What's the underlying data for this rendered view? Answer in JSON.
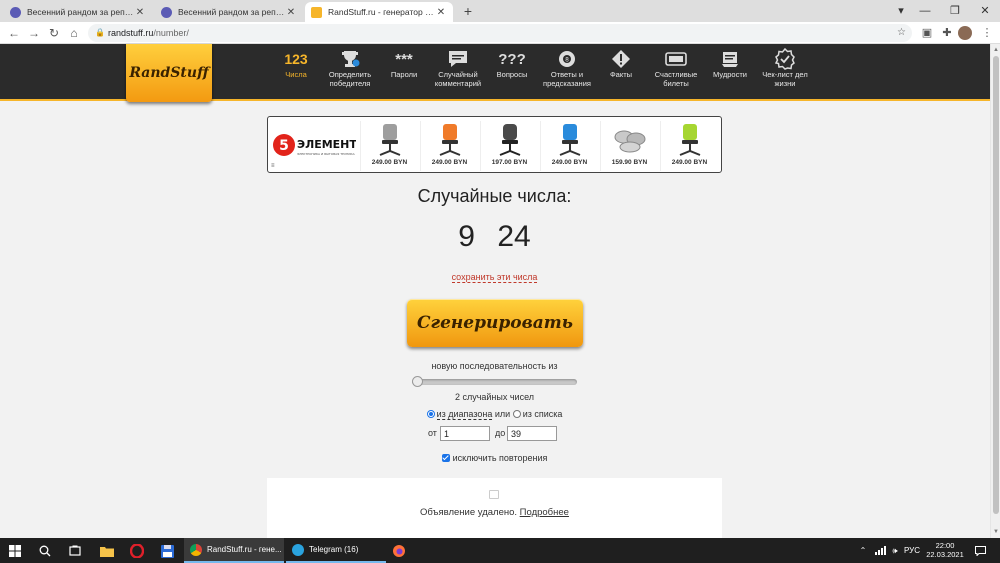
{
  "browser": {
    "tabs": [
      {
        "title": "Весенний рандом за репост! - К"
      },
      {
        "title": "Весенний рандом за репост! - К"
      },
      {
        "title": "RandStuff.ru - генератор случай"
      }
    ],
    "url_host": "randstuff.ru",
    "url_path": "/number/"
  },
  "site": {
    "logo": "RandStuff",
    "menu": [
      {
        "label": "Числа",
        "glyph": "123",
        "icon": "numbers-icon"
      },
      {
        "label": "Определить победителя",
        "icon": "trophy-icon"
      },
      {
        "label": "Пароли",
        "glyph": "***",
        "icon": "password-icon"
      },
      {
        "label": "Случайный комментарий",
        "icon": "comment-icon"
      },
      {
        "label": "Вопросы",
        "glyph": "???",
        "icon": "question-icon"
      },
      {
        "label": "Ответы и предсказания",
        "icon": "magic-ball-icon"
      },
      {
        "label": "Факты",
        "icon": "fact-icon"
      },
      {
        "label": "Счастливые билеты",
        "icon": "ticket-icon"
      },
      {
        "label": "Мудрости",
        "icon": "wisdom-icon"
      },
      {
        "label": "Чек-лист дел жизни",
        "icon": "checklist-icon"
      }
    ]
  },
  "ad": {
    "brand": "ЭЛЕМЕНТ",
    "brand_digit": "5",
    "brand_sub": "ЭЛЕКТРОНИКА И БЫТОВАЯ ТЕХНИКА",
    "products": [
      {
        "price": "249.00 BYN",
        "color": "#9e9e9e"
      },
      {
        "price": "249.00 BYN",
        "color": "#f07b2a"
      },
      {
        "price": "197.00 BYN",
        "color": "#4a4a4a"
      },
      {
        "price": "249.00 BYN",
        "color": "#2a8bdc"
      },
      {
        "price": "159.90 BYN",
        "color": "#b8b8b8"
      },
      {
        "price": "249.00 BYN",
        "color": "#a6d631"
      }
    ],
    "menu_glyph": "≡"
  },
  "main": {
    "title": "Случайные числа:",
    "numbers": "9 24",
    "save_link": "сохранить эти числа",
    "generate_button": "Сгенерировать",
    "sequence_label": "новую последовательность из",
    "slider_fraction": 0.0,
    "count_label": "2 случайных чисел",
    "mode_range": "из диапазона",
    "mode_or": "или",
    "mode_list": "из списка",
    "from_label": "от",
    "from_value": "1",
    "to_label": "до",
    "to_value": "39",
    "exclude_label": "исключить повторения"
  },
  "ad_removed": {
    "text": "Объявление удалено.",
    "link": "Подробнее"
  },
  "taskbar": {
    "apps": [
      {
        "label": "RandStuff.ru - генe...",
        "color": "#4caf50"
      },
      {
        "label": "Telegram (16)",
        "color": "#2aa3df"
      }
    ],
    "lang": "РУС",
    "time": "22:00",
    "date": "22.03.2021"
  },
  "colors": {
    "accent": "#f6b52a",
    "header_bg": "#2b2b2b",
    "link_red": "#c0392b"
  }
}
